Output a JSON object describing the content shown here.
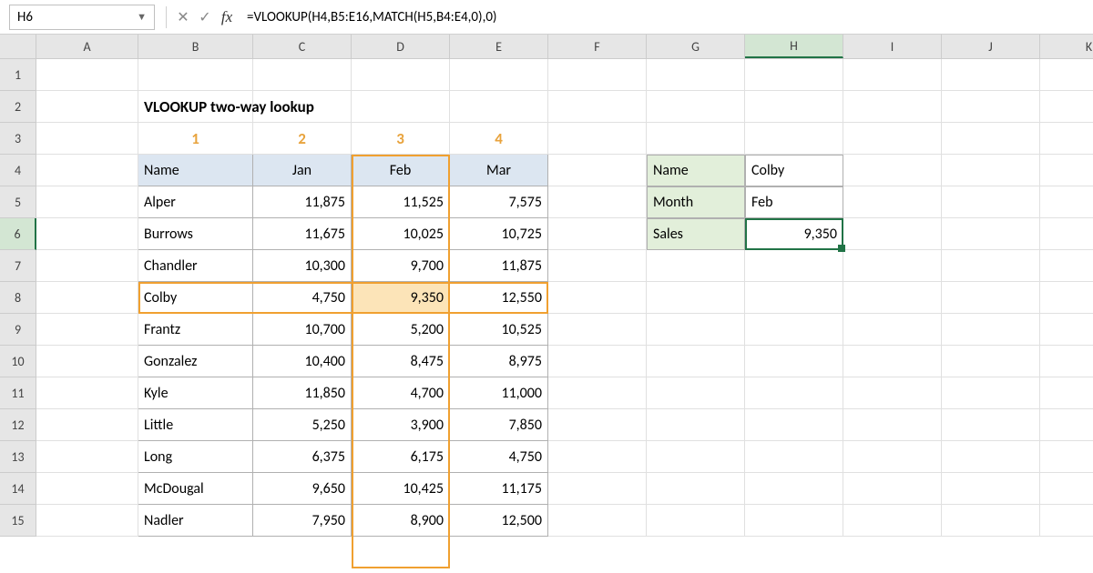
{
  "formula_bar": {
    "cell_ref": "H6",
    "formula": "=VLOOKUP(H4,B5:E16,MATCH(H5,B4:E4,0),0)",
    "fx_label": "fx"
  },
  "columns": [
    "A",
    "B",
    "C",
    "D",
    "E",
    "F",
    "G",
    "H",
    "I",
    "J",
    "K"
  ],
  "rows": [
    "1",
    "2",
    "3",
    "4",
    "5",
    "6",
    "7",
    "8",
    "9",
    "10",
    "11",
    "12",
    "13",
    "14",
    "15"
  ],
  "title": "VLOOKUP two-way lookup",
  "col_numbers": [
    "1",
    "2",
    "3",
    "4"
  ],
  "table": {
    "headers": [
      "Name",
      "Jan",
      "Feb",
      "Mar"
    ],
    "data": [
      [
        "Alper",
        "11,875",
        "11,525",
        "7,575"
      ],
      [
        "Burrows",
        "11,675",
        "10,025",
        "10,725"
      ],
      [
        "Chandler",
        "10,300",
        "9,700",
        "11,875"
      ],
      [
        "Colby",
        "4,750",
        "9,350",
        "12,550"
      ],
      [
        "Frantz",
        "10,700",
        "5,200",
        "10,525"
      ],
      [
        "Gonzalez",
        "10,400",
        "8,475",
        "8,975"
      ],
      [
        "Kyle",
        "11,850",
        "4,700",
        "11,000"
      ],
      [
        "Little",
        "5,250",
        "3,900",
        "7,850"
      ],
      [
        "Long",
        "6,375",
        "6,175",
        "4,750"
      ],
      [
        "McDougal",
        "9,650",
        "10,425",
        "11,175"
      ],
      [
        "Nadler",
        "7,950",
        "8,900",
        "12,500"
      ]
    ]
  },
  "lookup": {
    "labels": [
      "Name",
      "Month",
      "Sales"
    ],
    "values": [
      "Colby",
      "Feb",
      "9,350"
    ]
  },
  "active_cell": "H6",
  "active_col": "H",
  "active_row": "6",
  "chart_data": {
    "type": "table",
    "title": "VLOOKUP two-way lookup",
    "columns": [
      "Name",
      "Jan",
      "Feb",
      "Mar"
    ],
    "rows": [
      {
        "Name": "Alper",
        "Jan": 11875,
        "Feb": 11525,
        "Mar": 7575
      },
      {
        "Name": "Burrows",
        "Jan": 11675,
        "Feb": 10025,
        "Mar": 10725
      },
      {
        "Name": "Chandler",
        "Jan": 10300,
        "Feb": 9700,
        "Mar": 11875
      },
      {
        "Name": "Colby",
        "Jan": 4750,
        "Feb": 9350,
        "Mar": 12550
      },
      {
        "Name": "Frantz",
        "Jan": 10700,
        "Feb": 5200,
        "Mar": 10525
      },
      {
        "Name": "Gonzalez",
        "Jan": 10400,
        "Feb": 8475,
        "Mar": 8975
      },
      {
        "Name": "Kyle",
        "Jan": 11850,
        "Feb": 4700,
        "Mar": 11000
      },
      {
        "Name": "Little",
        "Jan": 5250,
        "Feb": 3900,
        "Mar": 7850
      },
      {
        "Name": "Long",
        "Jan": 6375,
        "Feb": 6175,
        "Mar": 4750
      },
      {
        "Name": "McDougal",
        "Jan": 9650,
        "Feb": 10425,
        "Mar": 11175
      },
      {
        "Name": "Nadler",
        "Jan": 7950,
        "Feb": 8900,
        "Mar": 12500
      }
    ],
    "lookup_result": {
      "Name": "Colby",
      "Month": "Feb",
      "Sales": 9350
    }
  }
}
